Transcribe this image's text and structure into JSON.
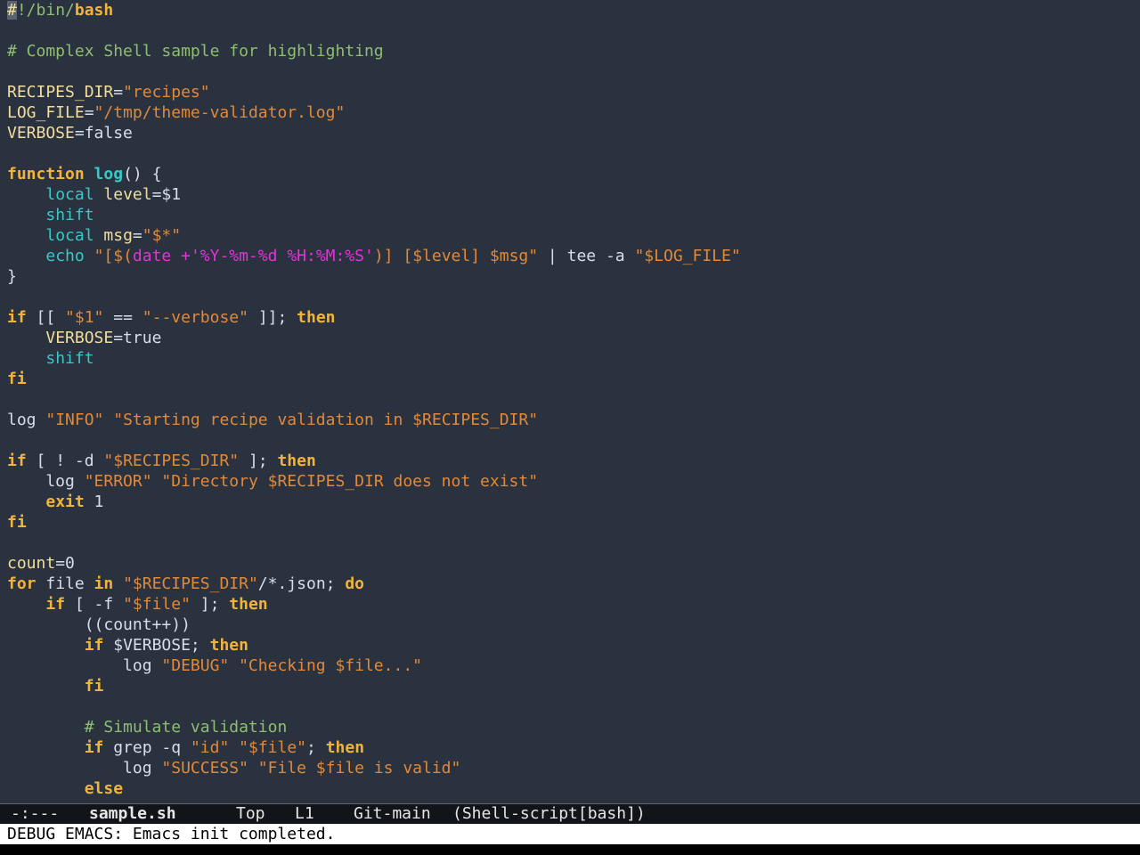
{
  "editor": {
    "lines": [
      [
        {
          "t": "#",
          "c": "cursor"
        },
        {
          "t": "!/bin/",
          "c": "cmt"
        },
        {
          "t": "bash",
          "c": "kw"
        }
      ],
      [],
      [
        {
          "t": "# Complex Shell sample for highlighting",
          "c": "cmt"
        }
      ],
      [],
      [
        {
          "t": "RECIPES_DIR",
          "c": "var"
        },
        {
          "t": "=",
          "c": "pl"
        },
        {
          "t": "\"recipes\"",
          "c": "str"
        }
      ],
      [
        {
          "t": "LOG_FILE",
          "c": "var"
        },
        {
          "t": "=",
          "c": "pl"
        },
        {
          "t": "\"/tmp/theme-validator.log\"",
          "c": "str"
        }
      ],
      [
        {
          "t": "VERBOSE",
          "c": "var"
        },
        {
          "t": "=false",
          "c": "pl"
        }
      ],
      [],
      [
        {
          "t": "function",
          "c": "kw"
        },
        {
          "t": " ",
          "c": "pl"
        },
        {
          "t": "log",
          "c": "fn"
        },
        {
          "t": "() {",
          "c": "pl"
        }
      ],
      [
        {
          "t": "    ",
          "c": "pl"
        },
        {
          "t": "local",
          "c": "bi"
        },
        {
          "t": " ",
          "c": "pl"
        },
        {
          "t": "level",
          "c": "var"
        },
        {
          "t": "=$1",
          "c": "pl"
        }
      ],
      [
        {
          "t": "    ",
          "c": "pl"
        },
        {
          "t": "shift",
          "c": "bi"
        }
      ],
      [
        {
          "t": "    ",
          "c": "pl"
        },
        {
          "t": "local",
          "c": "bi"
        },
        {
          "t": " ",
          "c": "pl"
        },
        {
          "t": "msg",
          "c": "var"
        },
        {
          "t": "=",
          "c": "pl"
        },
        {
          "t": "\"$*\"",
          "c": "str"
        }
      ],
      [
        {
          "t": "    ",
          "c": "pl"
        },
        {
          "t": "echo",
          "c": "bi"
        },
        {
          "t": " ",
          "c": "pl"
        },
        {
          "t": "\"[$(",
          "c": "str"
        },
        {
          "t": "date +'%Y-%m-%d %H:%M:%S'",
          "c": "sub"
        },
        {
          "t": ")] [$level] $msg\"",
          "c": "str"
        },
        {
          "t": " | tee -a ",
          "c": "pl"
        },
        {
          "t": "\"$LOG_FILE\"",
          "c": "str"
        }
      ],
      [
        {
          "t": "}",
          "c": "pl"
        }
      ],
      [],
      [
        {
          "t": "if",
          "c": "kw"
        },
        {
          "t": " [[ ",
          "c": "pl"
        },
        {
          "t": "\"$1\"",
          "c": "str"
        },
        {
          "t": " == ",
          "c": "pl"
        },
        {
          "t": "\"--verbose\"",
          "c": "str"
        },
        {
          "t": " ]]; ",
          "c": "pl"
        },
        {
          "t": "then",
          "c": "kw"
        }
      ],
      [
        {
          "t": "    ",
          "c": "pl"
        },
        {
          "t": "VERBOSE",
          "c": "var"
        },
        {
          "t": "=true",
          "c": "pl"
        }
      ],
      [
        {
          "t": "    ",
          "c": "pl"
        },
        {
          "t": "shift",
          "c": "bi"
        }
      ],
      [
        {
          "t": "fi",
          "c": "kw"
        }
      ],
      [],
      [
        {
          "t": "log ",
          "c": "pl"
        },
        {
          "t": "\"INFO\"",
          "c": "str"
        },
        {
          "t": " ",
          "c": "pl"
        },
        {
          "t": "\"Starting recipe validation in $RECIPES_DIR\"",
          "c": "str"
        }
      ],
      [],
      [
        {
          "t": "if",
          "c": "kw"
        },
        {
          "t": " [ ! -d ",
          "c": "pl"
        },
        {
          "t": "\"$RECIPES_DIR\"",
          "c": "str"
        },
        {
          "t": " ]; ",
          "c": "pl"
        },
        {
          "t": "then",
          "c": "kw"
        }
      ],
      [
        {
          "t": "    log ",
          "c": "pl"
        },
        {
          "t": "\"ERROR\"",
          "c": "str"
        },
        {
          "t": " ",
          "c": "pl"
        },
        {
          "t": "\"Directory $RECIPES_DIR does not exist\"",
          "c": "str"
        }
      ],
      [
        {
          "t": "    ",
          "c": "pl"
        },
        {
          "t": "exit",
          "c": "kw"
        },
        {
          "t": " 1",
          "c": "pl"
        }
      ],
      [
        {
          "t": "fi",
          "c": "kw"
        }
      ],
      [],
      [
        {
          "t": "count",
          "c": "var"
        },
        {
          "t": "=0",
          "c": "pl"
        }
      ],
      [
        {
          "t": "for",
          "c": "kw"
        },
        {
          "t": " file ",
          "c": "pl"
        },
        {
          "t": "in",
          "c": "kw"
        },
        {
          "t": " ",
          "c": "pl"
        },
        {
          "t": "\"$RECIPES_DIR\"",
          "c": "str"
        },
        {
          "t": "/*.json; ",
          "c": "pl"
        },
        {
          "t": "do",
          "c": "kw"
        }
      ],
      [
        {
          "t": "    ",
          "c": "pl"
        },
        {
          "t": "if",
          "c": "kw"
        },
        {
          "t": " [ -f ",
          "c": "pl"
        },
        {
          "t": "\"$file\"",
          "c": "str"
        },
        {
          "t": " ]; ",
          "c": "pl"
        },
        {
          "t": "then",
          "c": "kw"
        }
      ],
      [
        {
          "t": "        ((count++))",
          "c": "pl"
        }
      ],
      [
        {
          "t": "        ",
          "c": "pl"
        },
        {
          "t": "if",
          "c": "kw"
        },
        {
          "t": " $VERBOSE; ",
          "c": "pl"
        },
        {
          "t": "then",
          "c": "kw"
        }
      ],
      [
        {
          "t": "            log ",
          "c": "pl"
        },
        {
          "t": "\"DEBUG\"",
          "c": "str"
        },
        {
          "t": " ",
          "c": "pl"
        },
        {
          "t": "\"Checking $file...\"",
          "c": "str"
        }
      ],
      [
        {
          "t": "        ",
          "c": "pl"
        },
        {
          "t": "fi",
          "c": "kw"
        }
      ],
      [],
      [
        {
          "t": "        ",
          "c": "pl"
        },
        {
          "t": "# Simulate validation",
          "c": "cmt"
        }
      ],
      [
        {
          "t": "        ",
          "c": "pl"
        },
        {
          "t": "if",
          "c": "kw"
        },
        {
          "t": " grep -q ",
          "c": "pl"
        },
        {
          "t": "\"id\"",
          "c": "str"
        },
        {
          "t": " ",
          "c": "pl"
        },
        {
          "t": "\"$file\"",
          "c": "str"
        },
        {
          "t": "; ",
          "c": "pl"
        },
        {
          "t": "then",
          "c": "kw"
        }
      ],
      [
        {
          "t": "            log ",
          "c": "pl"
        },
        {
          "t": "\"SUCCESS\"",
          "c": "str"
        },
        {
          "t": " ",
          "c": "pl"
        },
        {
          "t": "\"File $file is valid\"",
          "c": "str"
        }
      ],
      [
        {
          "t": "        ",
          "c": "pl"
        },
        {
          "t": "else",
          "c": "kw"
        }
      ]
    ]
  },
  "modeline": {
    "status": "-:---",
    "buffer": "sample.sh",
    "position": "Top",
    "line": "L1",
    "vc": "Git-main",
    "mode": "(Shell-script[bash])"
  },
  "echo_area": {
    "message": "DEBUG EMACS: Emacs init completed."
  }
}
